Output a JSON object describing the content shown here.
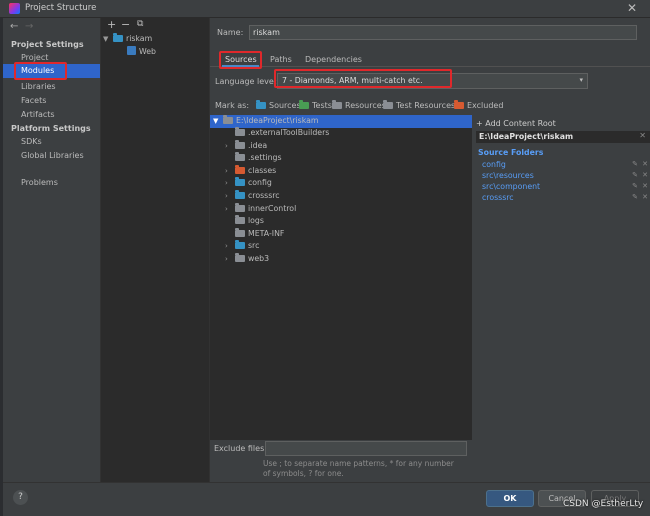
{
  "window": {
    "title": "Project Structure",
    "close_glyph": "✕"
  },
  "nav": {
    "back": "←",
    "forward": "→",
    "project_settings_header": "Project Settings",
    "project_settings_items": [
      "Project",
      "Modules",
      "Libraries",
      "Facets",
      "Artifacts"
    ],
    "platform_settings_header": "Platform Settings",
    "platform_settings_items": [
      "SDKs",
      "Global Libraries"
    ],
    "problems": "Problems"
  },
  "modules_toolbar": {
    "add": "+",
    "remove": "−",
    "copy": "⧉"
  },
  "module_tree": {
    "module": "riskam",
    "facet": "Web"
  },
  "module": {
    "name_label": "Name:",
    "name_value": "riskam",
    "tabs": [
      "Sources",
      "Paths",
      "Dependencies"
    ],
    "language_level_label": "Language level:",
    "language_level_value": "7 - Diamonds, ARM, multi-catch etc.",
    "mark_as_label": "Mark as:",
    "mark_as_options": [
      "Sources",
      "Tests",
      "Resources",
      "Test Resources",
      "Excluded"
    ],
    "root": "E:\\IdeaProject\\riskam",
    "folders": [
      {
        "name": ".externalToolBuilders",
        "expandable": false,
        "color": "grey"
      },
      {
        "name": ".idea",
        "expandable": true,
        "color": "grey"
      },
      {
        "name": ".settings",
        "expandable": false,
        "color": "grey"
      },
      {
        "name": "classes",
        "expandable": true,
        "color": "orange"
      },
      {
        "name": "config",
        "expandable": true,
        "color": "blue"
      },
      {
        "name": "crosssrc",
        "expandable": true,
        "color": "blue"
      },
      {
        "name": "innerControl",
        "expandable": true,
        "color": "grey"
      },
      {
        "name": "logs",
        "expandable": false,
        "color": "grey"
      },
      {
        "name": "META-INF",
        "expandable": false,
        "color": "grey"
      },
      {
        "name": "src",
        "expandable": true,
        "color": "blue"
      },
      {
        "name": "web3",
        "expandable": true,
        "color": "grey"
      }
    ],
    "add_content_root": "+ Add Content Root",
    "content_root_path": "E:\\IdeaProject\\riskam",
    "source_folders_header": "Source Folders",
    "source_folders": [
      "config",
      "src\\resources",
      "src\\component",
      "crosssrc"
    ],
    "exclude_files_label": "Exclude files:",
    "exclude_hint": "Use ; to separate name patterns, * for any number of symbols, ? for one."
  },
  "footer": {
    "help": "?",
    "ok": "OK",
    "cancel": "Cancel",
    "apply": "Apply",
    "watermark": "CSDN @EstherLty"
  },
  "colors": {
    "accent": "#2f65ca",
    "highlight_box": "#e0282b",
    "ok_button": "#365880",
    "source_folder": "#3592c4",
    "excluded_folder": "#d65a31"
  }
}
